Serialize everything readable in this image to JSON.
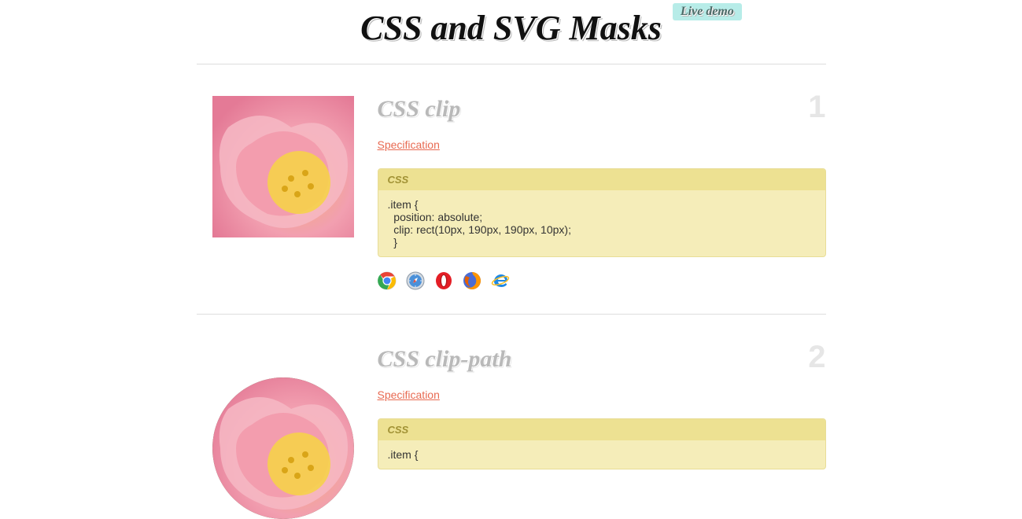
{
  "header": {
    "title": "CSS and SVG Masks",
    "badge": "Live demo"
  },
  "sections": [
    {
      "number": "1",
      "title": "CSS clip",
      "spec_label": "Specification",
      "code_label": "CSS",
      "code": ".item {\n  position: absolute;\n  clip: rect(10px, 190px, 190px, 10px);\n  }",
      "preview_shape": "square",
      "browsers": [
        "chrome",
        "safari",
        "opera",
        "firefox",
        "ie"
      ]
    },
    {
      "number": "2",
      "title": "CSS clip-path",
      "spec_label": "Specification",
      "code_label": "CSS",
      "code": ".item {",
      "preview_shape": "round",
      "browsers": []
    }
  ]
}
